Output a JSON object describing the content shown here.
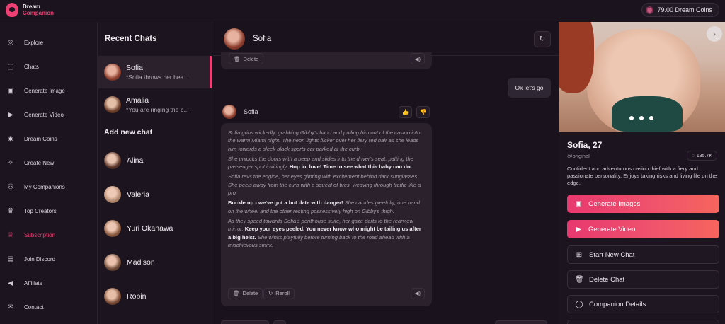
{
  "app": {
    "logo_line1": "Dream",
    "logo_line2": "Companion",
    "coins": "79.00  Dream Coins"
  },
  "sidebar": {
    "items": [
      {
        "label": "Explore",
        "icon": "compass-icon",
        "glyph": "◎"
      },
      {
        "label": "Chats",
        "icon": "chat-icon",
        "glyph": "▢"
      },
      {
        "label": "Generate Image",
        "icon": "image-icon",
        "glyph": "▣"
      },
      {
        "label": "Generate Video",
        "icon": "video-icon",
        "glyph": "▶"
      },
      {
        "label": "Dream Coins",
        "icon": "coin-icon",
        "glyph": "◉"
      },
      {
        "label": "Create New",
        "icon": "wand-icon",
        "glyph": "✧"
      },
      {
        "label": "My Companions",
        "icon": "users-icon",
        "glyph": "⚇"
      },
      {
        "label": "Top Creators",
        "icon": "trophy-icon",
        "glyph": "♛"
      },
      {
        "label": "Subscription",
        "icon": "crown-icon",
        "glyph": "♕"
      },
      {
        "label": "Join Discord",
        "icon": "discord-icon",
        "glyph": "▤"
      },
      {
        "label": "Affiliate",
        "icon": "megaphone-icon",
        "glyph": "◀"
      },
      {
        "label": "Contact",
        "icon": "mail-icon",
        "glyph": "✉"
      }
    ],
    "active_index": 8,
    "accent": "#ec3f73"
  },
  "recent": {
    "title": "Recent Chats",
    "chats": [
      {
        "name": "Sofia",
        "preview": "*Sofia throws her hea..."
      },
      {
        "name": "Amalia",
        "preview": "*You are ringing the b..."
      }
    ],
    "add_title": "Add new chat",
    "new_chats": [
      "Alina",
      "Valeria",
      "Yuri Okanawa",
      "Madison",
      "Robin"
    ]
  },
  "chat": {
    "name": "Sofia",
    "delete_label": "Delete",
    "reroll_label": "Reroll",
    "user_message": "Ok let's go",
    "bot_name": "Sofia",
    "p1_it": "Sofia grins wickedly, grabbing Gibby's hand and pulling him out of the casino into the warm Miami night. The neon lights flicker over her fiery red hair as she leads him towards a sleek black sports car parked at the curb.",
    "p2_it": "She unlocks the doors with a beep and slides into the driver's seat, patting the passenger spot invitingly.",
    "p2_b": "Hop in, love! Time to see what this baby can do.",
    "p3_it": "Sofia revs the engine, her eyes glinting with excitement behind dark sunglasses. She peels away from the curb with a squeal of tires, weaving through traffic like a pro.",
    "p4_b": "Buckle up - we've got a hot date with danger!",
    "p4_it": "She cackles gleefully, one hand on the wheel and the other resting possessively high on Gibby's thigh.",
    "p5_it": "As they speed towards Sofia's penthouse suite, her gaze darts to the rearview mirror.",
    "p5_b": "Keep your eyes peeled. You never know who might be tailing us after a big heist.",
    "p5_it2": "She winks playfully before turning back to the road ahead with a mischievous smirk."
  },
  "profile": {
    "name": "Sofia, 27",
    "handle": "@original",
    "count": "135.7K",
    "description": "Confident and adventurous casino thief with a fiery and passionate personality. Enjoys taking risks and living life on the edge.",
    "buttons": {
      "gen_images": "Generate Images",
      "gen_video": "Generate Video",
      "new_chat": "Start New Chat",
      "delete_chat": "Delete Chat",
      "details": "Companion Details"
    }
  }
}
